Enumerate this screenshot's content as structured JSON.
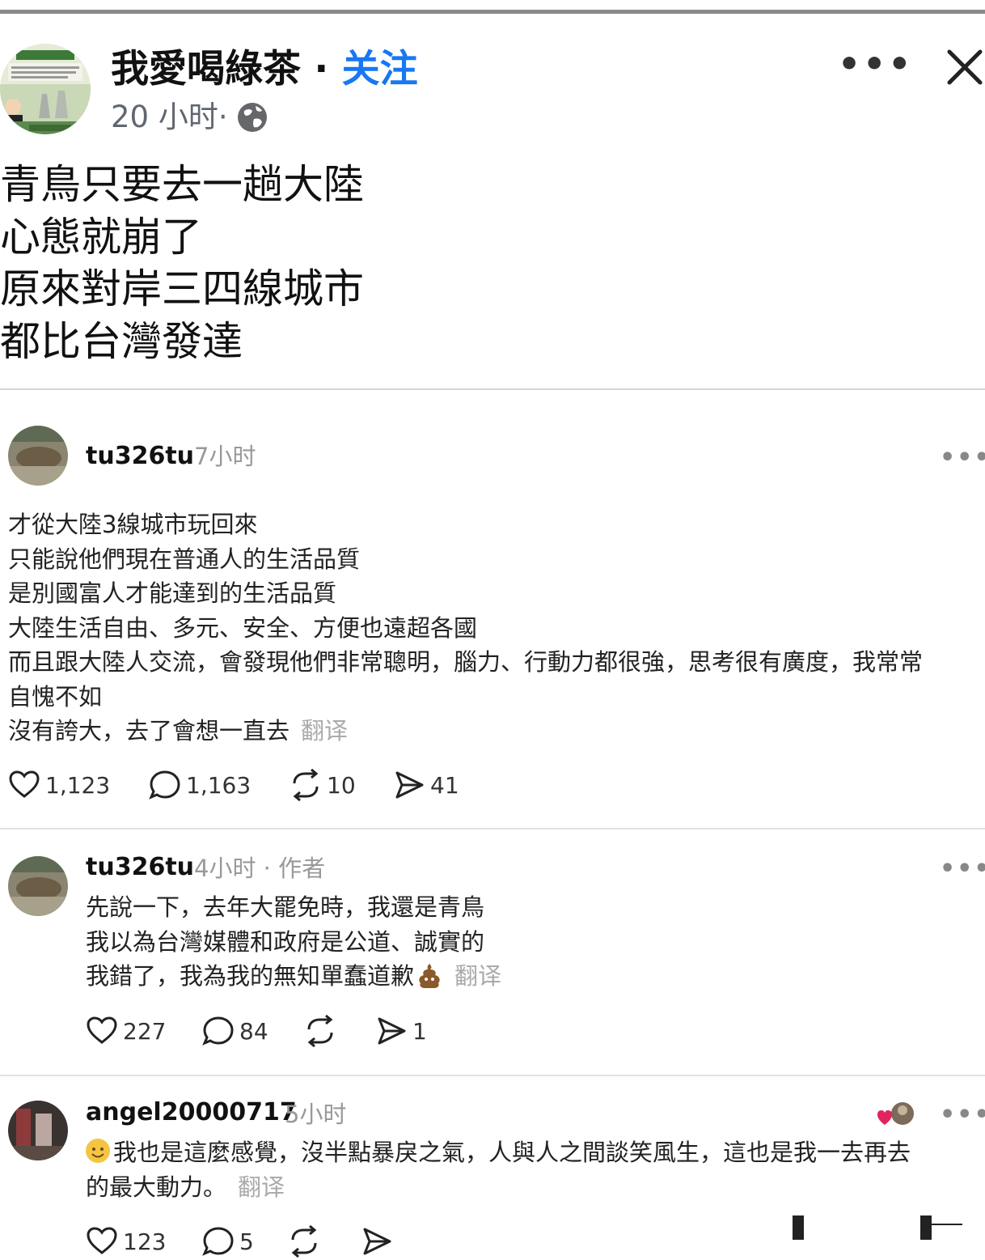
{
  "post": {
    "author": "我愛喝綠茶",
    "separator": " · ",
    "follow_label": "关注",
    "time": "20 小时",
    "dot": " · ",
    "lines": [
      "青鳥只要去一趟大陸",
      "心態就崩了",
      "原來對岸三四線城市",
      "都比台灣發達"
    ],
    "more_label": "•••"
  },
  "comments": [
    {
      "user": "tu326tu",
      "time": "7小时",
      "lines": [
        "才從大陸3線城市玩回來",
        "只能說他們現在普通人的生活品質",
        "是別國富人才能達到的生活品質",
        "大陸生活自由、多元、安全、方便也遠超各國",
        "而且跟大陸人交流，會發現他們非常聰明，腦力、行動力都很強，思考很有廣度，我常常",
        "自愧不如",
        "沒有誇大，去了會想一直去"
      ],
      "translate": "翻译",
      "likes": "1,123",
      "replies": "1,163",
      "reposts": "10",
      "shares": "41"
    },
    {
      "user": "tu326tu",
      "time": "4小时 · 作者",
      "lines": [
        "先說一下，去年大罷免時，我還是青鳥",
        "我以為台灣媒體和政府是公道、誠實的",
        "我錯了，我為我的無知單蠢道歉"
      ],
      "translate": "翻译",
      "likes": "227",
      "replies": "84",
      "reposts": "",
      "shares": "1"
    },
    {
      "user": "angel20000717",
      "time": "5小时",
      "lines": [
        "我也是這麼感覺，沒半點暴戾之氣，人與人之間談笑風生，這也是我一去再去",
        "的最大動力。"
      ],
      "translate": "翻译",
      "likes": "123",
      "replies": "5",
      "reposts": "",
      "shares": ""
    }
  ],
  "colors": {
    "follow": "#1877f2",
    "meta": "#606770",
    "muted": "#999999"
  },
  "icons": [
    "globe-icon",
    "more-icon",
    "close-icon",
    "heart-icon",
    "comment-icon",
    "repost-icon",
    "share-icon"
  ]
}
